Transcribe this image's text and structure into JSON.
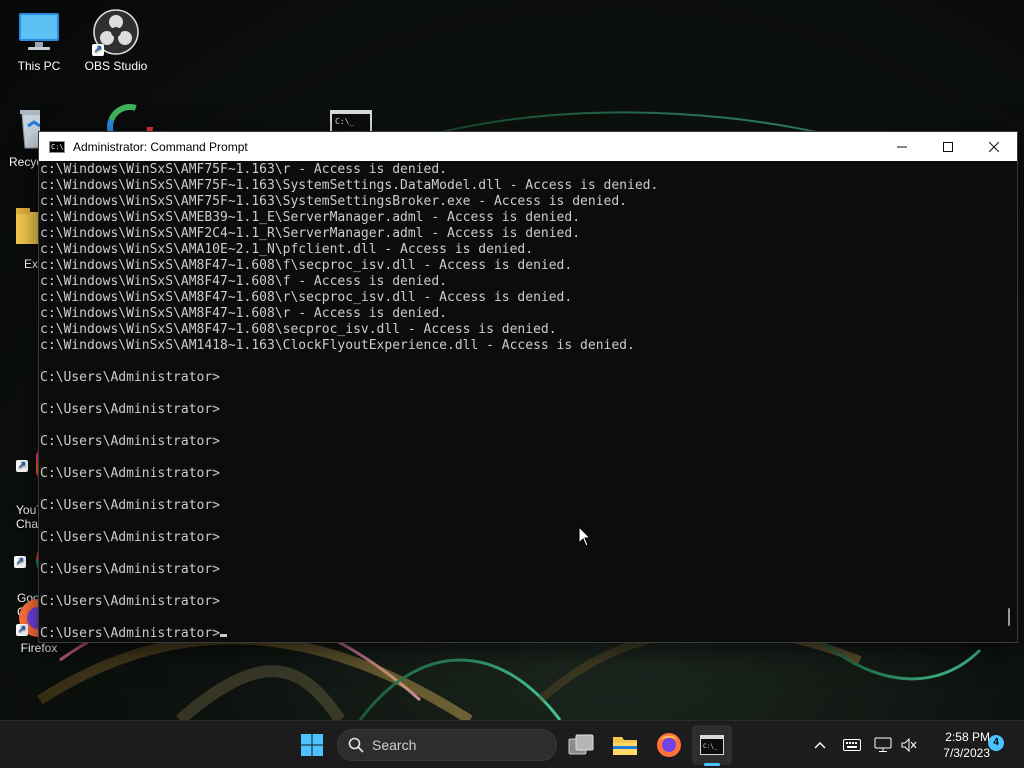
{
  "window": {
    "title": "Administrator: Command Prompt",
    "icon_glyph": "C:\\_"
  },
  "console": {
    "lines": [
      "c:\\Windows\\WinSxS\\AMF75F~1.163\\r - Access is denied.",
      "c:\\Windows\\WinSxS\\AMF75F~1.163\\SystemSettings.DataModel.dll - Access is denied.",
      "c:\\Windows\\WinSxS\\AMF75F~1.163\\SystemSettingsBroker.exe - Access is denied.",
      "c:\\Windows\\WinSxS\\AMEB39~1.1_E\\ServerManager.adml - Access is denied.",
      "c:\\Windows\\WinSxS\\AMF2C4~1.1_R\\ServerManager.adml - Access is denied.",
      "c:\\Windows\\WinSxS\\AMA10E~2.1_N\\pfclient.dll - Access is denied.",
      "c:\\Windows\\WinSxS\\AM8F47~1.608\\f\\secproc_isv.dll - Access is denied.",
      "c:\\Windows\\WinSxS\\AM8F47~1.608\\f - Access is denied.",
      "c:\\Windows\\WinSxS\\AM8F47~1.608\\r\\secproc_isv.dll - Access is denied.",
      "c:\\Windows\\WinSxS\\AM8F47~1.608\\r - Access is denied.",
      "c:\\Windows\\WinSxS\\AM8F47~1.608\\secproc_isv.dll - Access is denied.",
      "c:\\Windows\\WinSxS\\AM1418~1.163\\ClockFlyoutExperience.dll - Access is denied.",
      "",
      "C:\\Users\\Administrator>",
      "",
      "C:\\Users\\Administrator>",
      "",
      "C:\\Users\\Administrator>",
      "",
      "C:\\Users\\Administrator>",
      "",
      "C:\\Users\\Administrator>",
      "",
      "C:\\Users\\Administrator>",
      "",
      "C:\\Users\\Administrator>",
      "",
      "C:\\Users\\Administrator>",
      "",
      "C:\\Users\\Administrator>"
    ]
  },
  "desktop": {
    "icons": [
      {
        "label": "This PC"
      },
      {
        "label": "OBS Studio"
      },
      {
        "label": "Recyc"
      },
      {
        "label": "Ext"
      },
      {
        "label": "YouT\nCha"
      },
      {
        "label": "Goo\nChr"
      },
      {
        "label": "Firefox"
      }
    ]
  },
  "taskbar": {
    "search_label": "Search",
    "time": "2:58 PM",
    "date": "7/3/2023",
    "notification_count": "4"
  },
  "colors": {
    "console_bg": "#0c0c0c",
    "console_text": "#cccccc",
    "titlebar_bg": "#ffffff",
    "taskbar_bg": "#1c1c1c",
    "accent": "#4cc2ff"
  }
}
